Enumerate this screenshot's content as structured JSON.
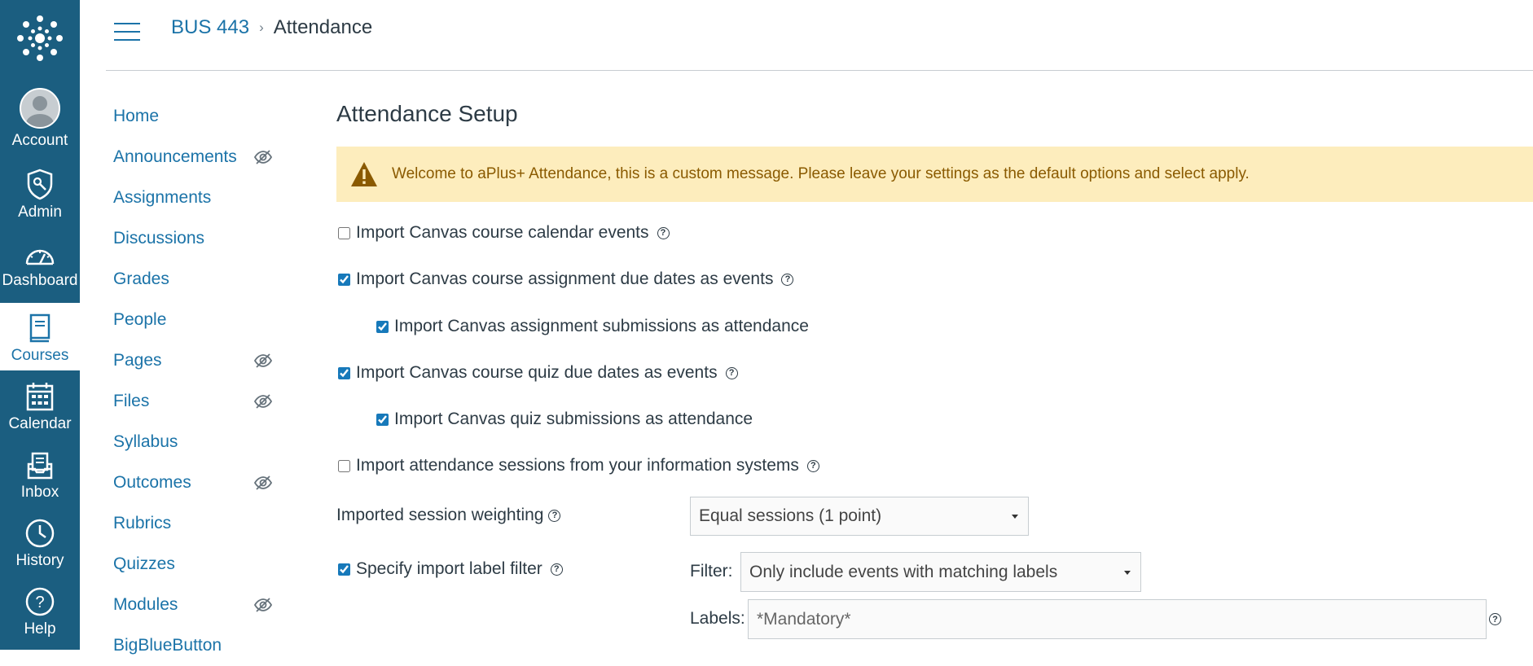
{
  "global_nav": {
    "items": [
      {
        "label": "Account",
        "icon": "avatar"
      },
      {
        "label": "Admin",
        "icon": "admin-shield-icon"
      },
      {
        "label": "Dashboard",
        "icon": "dashboard-gauge-icon"
      },
      {
        "label": "Courses",
        "icon": "courses-book-icon",
        "active": true
      },
      {
        "label": "Calendar",
        "icon": "calendar-icon"
      },
      {
        "label": "Inbox",
        "icon": "inbox-icon"
      },
      {
        "label": "History",
        "icon": "history-clock-icon"
      },
      {
        "label": "Help",
        "icon": "help-question-icon"
      }
    ],
    "colors": {
      "background": "#1b5e80",
      "active_bg": "#ffffff",
      "active_text": "#1b73a8"
    }
  },
  "header": {
    "breadcrumb": {
      "course": "BUS 443",
      "separator": "›",
      "current": "Attendance"
    }
  },
  "course_nav": {
    "items": [
      {
        "label": "Home",
        "hidden_icon": false
      },
      {
        "label": "Announcements",
        "hidden_icon": true
      },
      {
        "label": "Assignments",
        "hidden_icon": false
      },
      {
        "label": "Discussions",
        "hidden_icon": false
      },
      {
        "label": "Grades",
        "hidden_icon": false
      },
      {
        "label": "People",
        "hidden_icon": false
      },
      {
        "label": "Pages",
        "hidden_icon": true
      },
      {
        "label": "Files",
        "hidden_icon": true
      },
      {
        "label": "Syllabus",
        "hidden_icon": false
      },
      {
        "label": "Outcomes",
        "hidden_icon": true
      },
      {
        "label": "Rubrics",
        "hidden_icon": false
      },
      {
        "label": "Quizzes",
        "hidden_icon": false
      },
      {
        "label": "Modules",
        "hidden_icon": true
      },
      {
        "label": "BigBlueButton",
        "hidden_icon": false
      }
    ]
  },
  "main": {
    "title": "Attendance Setup",
    "alert": {
      "text": "Welcome to aPlus+ Attendance, this is a custom message. Please leave your settings as the default options and select apply.",
      "icon": "warning-triangle-icon",
      "bg_color": "#fdedbd",
      "text_color": "#8a5a00"
    },
    "options": {
      "calendar_events": {
        "label": "Import Canvas course calendar events",
        "checked": false
      },
      "assignment_due": {
        "label": "Import Canvas course assignment due dates as events",
        "checked": true
      },
      "assignment_submissions": {
        "label": "Import Canvas assignment submissions as attendance",
        "checked": true
      },
      "quiz_due": {
        "label": "Import Canvas course quiz due dates as events",
        "checked": true
      },
      "quiz_submissions": {
        "label": "Import Canvas quiz submissions as attendance",
        "checked": true
      },
      "info_systems": {
        "label": "Import attendance sessions from your information systems",
        "checked": false
      },
      "label_filter": {
        "label": "Specify import label filter",
        "checked": true
      }
    },
    "weighting": {
      "label": "Imported session weighting",
      "value": "Equal sessions (1 point)"
    },
    "filter": {
      "label": "Filter:",
      "value": "Only include events with matching labels"
    },
    "labels": {
      "label": "Labels:",
      "value": "*Mandatory*"
    }
  }
}
